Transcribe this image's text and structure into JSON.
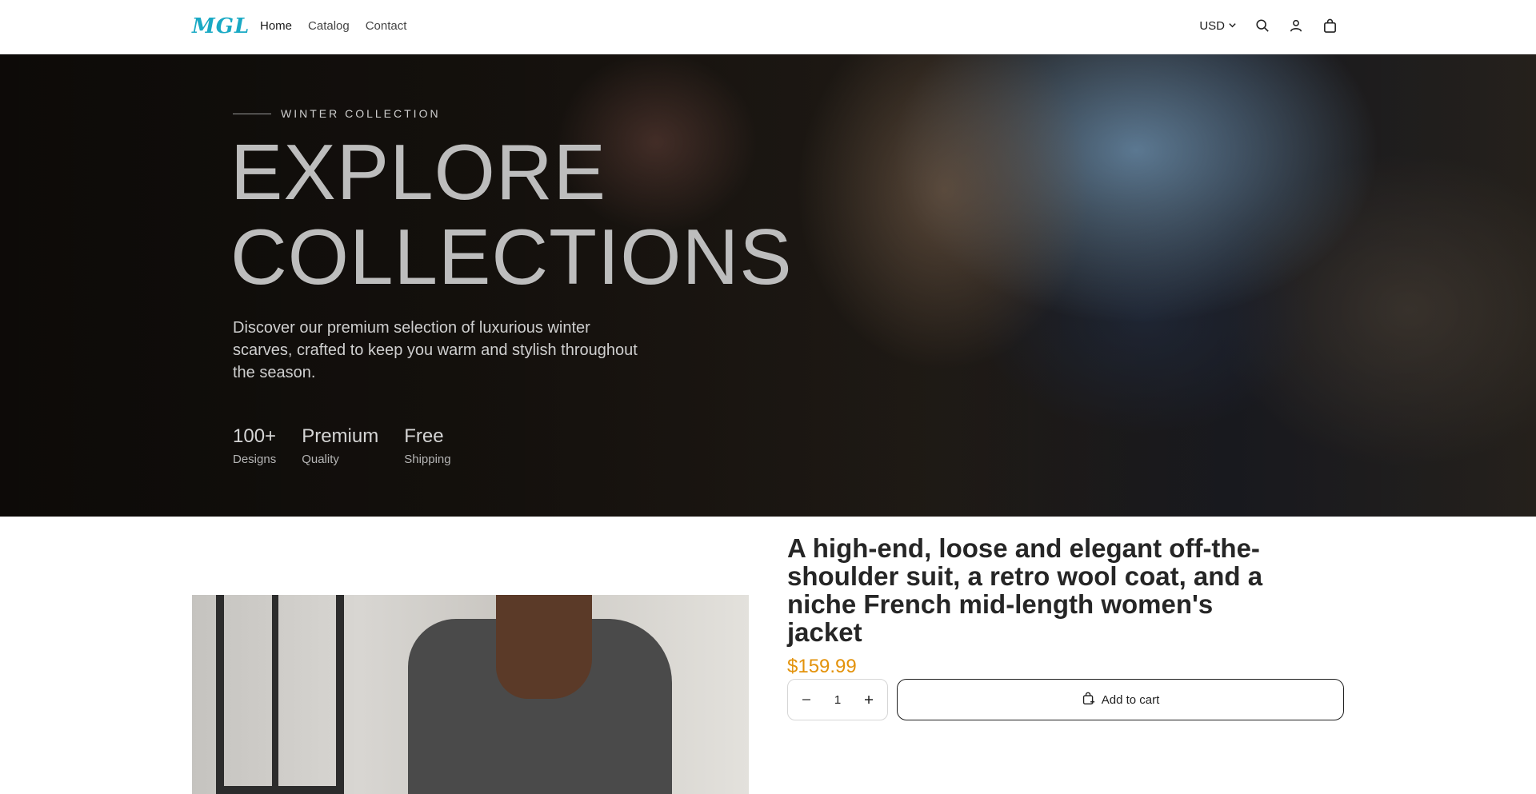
{
  "header": {
    "logo": "MGL",
    "nav": [
      {
        "label": "Home"
      },
      {
        "label": "Catalog"
      },
      {
        "label": "Contact"
      }
    ],
    "currency": "USD",
    "icons": [
      "search-icon",
      "account-icon",
      "cart-bag-icon"
    ]
  },
  "hero": {
    "eyebrow": "WINTER COLLECTION",
    "title_line1": "EXPLORE",
    "title_line2": "COLLECTIONS",
    "description": "Discover our premium selection of luxurious winter scarves, crafted to keep you warm and stylish throughout the season.",
    "stats": [
      {
        "value": "100+",
        "label": "Designs"
      },
      {
        "value": "Premium",
        "label": "Quality"
      },
      {
        "value": "Free",
        "label": "Shipping"
      }
    ]
  },
  "product": {
    "title": "A high-end, loose and elegant off-the-shoulder suit, a retro wool coat, and a niche French mid-length women's jacket",
    "price": "$159.99",
    "quantity": "1",
    "add_to_cart_label": "Add to cart"
  },
  "colors": {
    "logo": "#19a9c4",
    "price": "#e3920a"
  }
}
